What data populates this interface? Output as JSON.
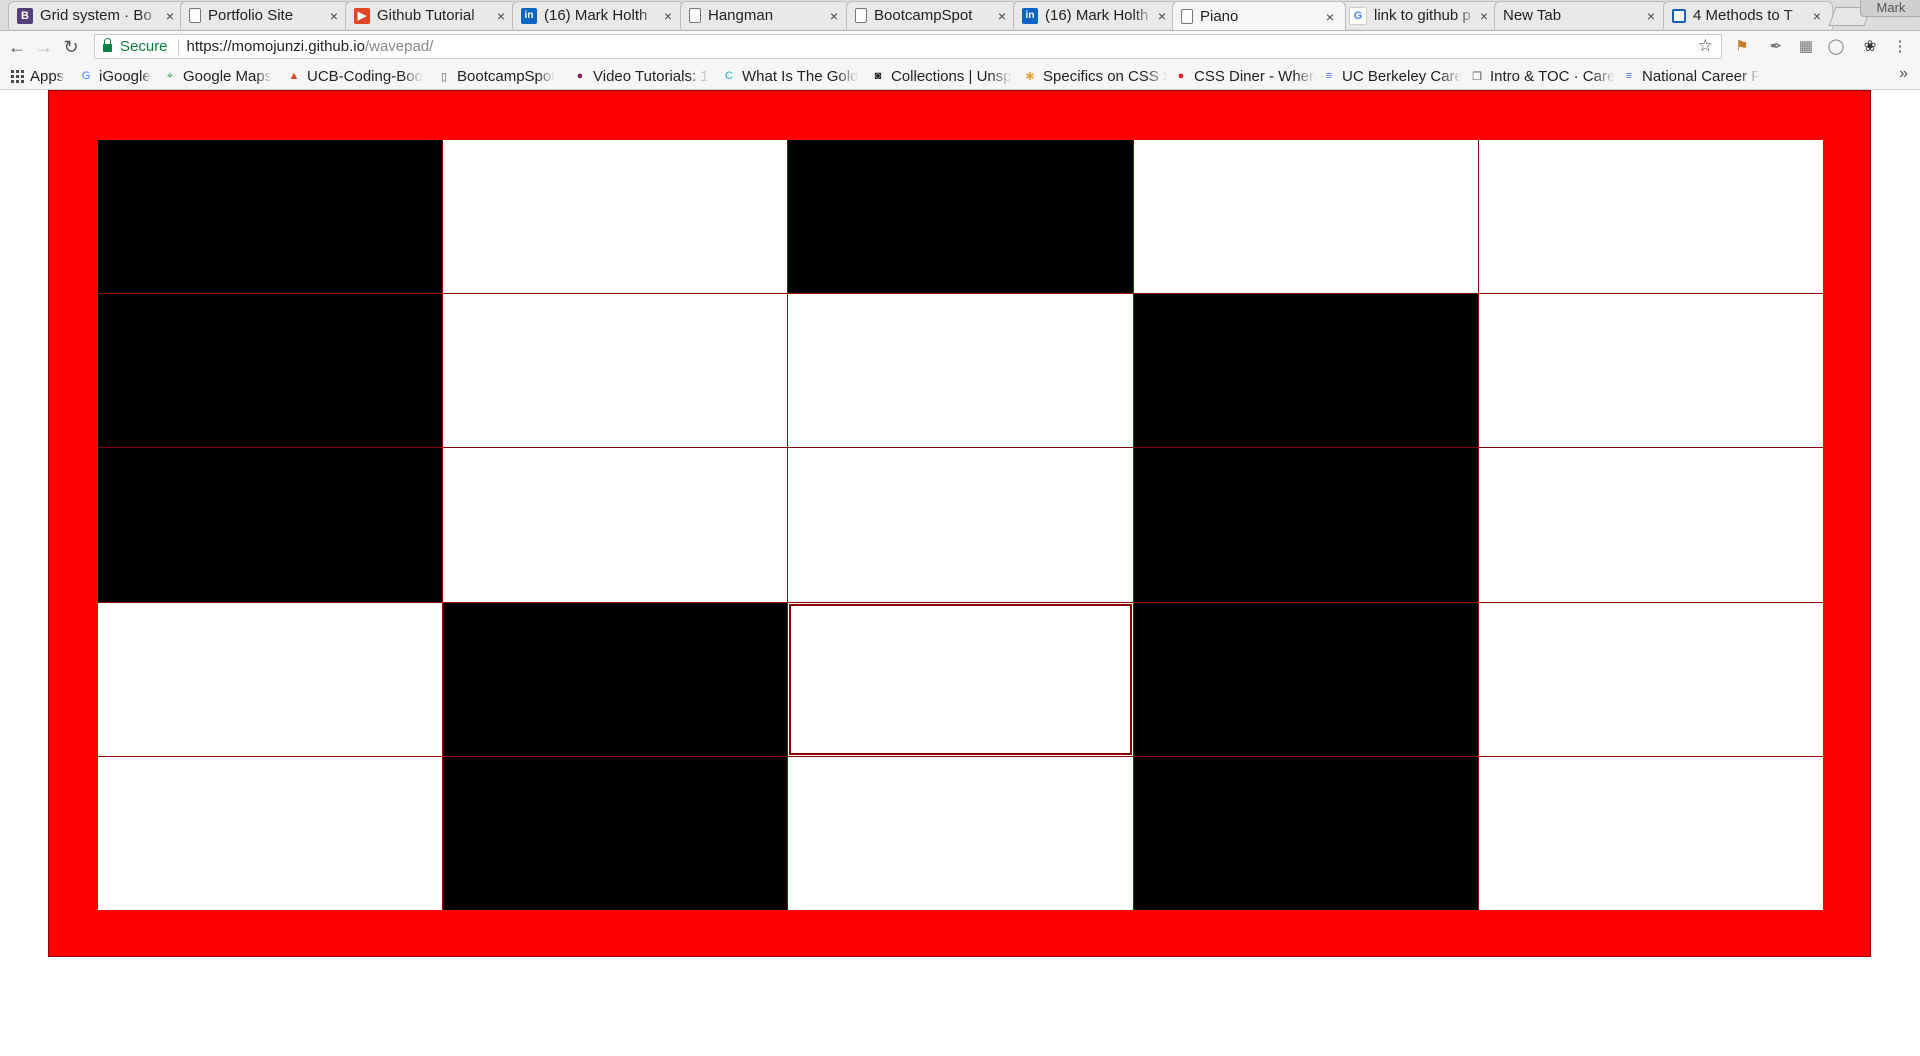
{
  "browser": {
    "tabs": [
      {
        "title": "Grid system · Bo",
        "favicon": "bootstrap-icon",
        "active": false
      },
      {
        "title": "Portfolio Site",
        "favicon": "page-icon",
        "active": false
      },
      {
        "title": "Github Tutorial",
        "favicon": "video-icon",
        "active": false
      },
      {
        "title": "(16) Mark Holth",
        "favicon": "linkedin-icon",
        "active": false
      },
      {
        "title": "Hangman",
        "favicon": "page-icon",
        "active": false
      },
      {
        "title": "BootcampSpot",
        "favicon": "page-icon",
        "active": false
      },
      {
        "title": "(16) Mark Holth",
        "favicon": "linkedin-icon",
        "active": false
      },
      {
        "title": "Piano",
        "favicon": "page-icon",
        "active": true
      },
      {
        "title": "link to github p",
        "favicon": "google-icon",
        "active": false
      },
      {
        "title": "New Tab",
        "favicon": "",
        "active": false
      },
      {
        "title": "4 Methods to T",
        "favicon": "box-icon",
        "active": false
      }
    ],
    "close_glyph": "×",
    "profile_name": "Mark",
    "address": {
      "secure_label": "Secure",
      "url_host": "https://momojunzi.github.io",
      "url_path": "/wavepad/"
    },
    "bookmarks": [
      {
        "label": "Apps",
        "icon": "apps-grid-icon"
      },
      {
        "label": "iGoogle",
        "icon": "google-icon"
      },
      {
        "label": "Google Maps",
        "icon": "maps-icon"
      },
      {
        "label": "UCB-Coding-Boo",
        "icon": "gitlab-icon"
      },
      {
        "label": "BootcampSpot",
        "icon": "page-icon"
      },
      {
        "label": "Video Tutorials: 1",
        "icon": "video-icon"
      },
      {
        "label": "What Is The Gold",
        "icon": "c-logo-icon"
      },
      {
        "label": "Collections | Unsp",
        "icon": "camera-icon"
      },
      {
        "label": "Specifics on CSS S",
        "icon": "asterisk-icon"
      },
      {
        "label": "CSS Diner - Where",
        "icon": "dot-icon"
      },
      {
        "label": "UC Berkeley Care",
        "icon": "doc-icon"
      },
      {
        "label": "Intro & TOC · Care",
        "icon": "book-icon"
      },
      {
        "label": "National Career F",
        "icon": "doc-icon"
      }
    ],
    "colors": {
      "secure": "#0b8043",
      "linkedin": "#0a66c2",
      "bootstrap": "#563d7c"
    }
  },
  "wavepad": {
    "colors": {
      "frame": "#ff0000",
      "border": "#8b0000",
      "black_key": "#000000",
      "white_key": "#ffffff"
    },
    "rows": [
      [
        "black",
        "white",
        "black",
        "white",
        "white"
      ],
      [
        "black",
        "white",
        "white",
        "black",
        "white"
      ],
      [
        "black",
        "white",
        "white",
        "black",
        "white"
      ],
      [
        "white",
        "black",
        "white",
        "black",
        "white"
      ],
      [
        "white",
        "black",
        "white",
        "black",
        "white"
      ]
    ],
    "focused_cell": {
      "row": 3,
      "col": 2
    }
  }
}
